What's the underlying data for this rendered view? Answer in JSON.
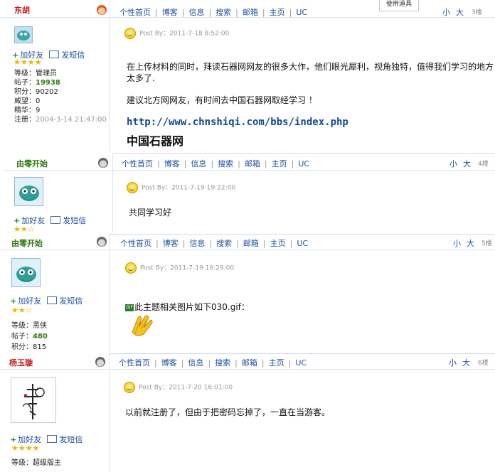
{
  "nav": [
    "个性首页",
    "博客",
    "信息",
    "搜索",
    "邮箱",
    "主页",
    "UC"
  ],
  "size": {
    "small": "小",
    "large": "大"
  },
  "tool_button": "使用道具",
  "actions": {
    "add_friend": "加好友",
    "send_msg": "发短信"
  },
  "posts": [
    {
      "user": "东胡",
      "floor": "3楼",
      "stars": "★★★★",
      "stats": [
        {
          "k": "等级：",
          "v": "管理员"
        },
        {
          "k": "帖子：",
          "v": "19938"
        },
        {
          "k": "积分：",
          "v": "90202"
        },
        {
          "k": "威望：",
          "v": "0"
        },
        {
          "k": "精华：",
          "v": "9"
        },
        {
          "k": "注册：",
          "v": "2004-3-14 21:47:00"
        }
      ],
      "postby": "Post By：2011-7-18 8:52:00",
      "text1": "在上传材料的同时，拜读石器网网友的很多大作，他们眼光犀利，视角独特，值得我们学习的地方",
      "text2": "太多了.",
      "text3": "建议北方网网友，有时间去中国石器网取经学习 ！",
      "link": "http://www.chnshiqi.com/bbs/index.php",
      "sitename": "中国石器网"
    },
    {
      "user": "由零开始",
      "floor": "4楼",
      "stars": "★★☆",
      "postby": "Post By：2011-7-19 19:22:00",
      "text1": "共同学习好"
    },
    {
      "user": "由零开始",
      "floor": "5楼",
      "stars": "★★☆",
      "stats": [
        {
          "k": "等级：",
          "v": "黑侠"
        },
        {
          "k": "帖子：",
          "v": "480"
        },
        {
          "k": "积分：",
          "v": "815"
        }
      ],
      "postby": "Post By：2011-7-19 19:29:00",
      "text1": "此主题相关图片如下030.gif："
    },
    {
      "user": "杨玉璇",
      "floor": "6楼",
      "stars": "★★★★",
      "stats": [
        {
          "k": "等级：",
          "v": "超级版主"
        }
      ],
      "postby": "Post By：2011-7-20 16:01:00",
      "text1": "以前就注册了，但由于把密码忘掉了，一直在当游客。"
    }
  ]
}
